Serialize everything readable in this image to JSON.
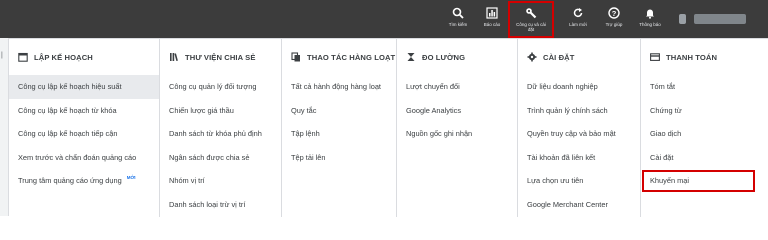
{
  "toolbar": {
    "buttons": [
      {
        "id": "search",
        "label": "Tìm kiếm",
        "icon": "search-icon"
      },
      {
        "id": "reports",
        "label": "Báo cáo",
        "icon": "reports-icon"
      },
      {
        "id": "tools",
        "label": "Công cụ và cài đặt",
        "icon": "wrench-icon"
      },
      {
        "id": "refresh",
        "label": "Làm mới",
        "icon": "refresh-icon"
      },
      {
        "id": "help",
        "label": "Trợ giúp",
        "icon": "help-icon"
      },
      {
        "id": "notifications",
        "label": "Thông báo",
        "icon": "bell-icon"
      }
    ]
  },
  "columns": [
    {
      "heading": "LẬP KẾ HOẠCH",
      "icon": "calendar-icon",
      "items": [
        {
          "label": "Công cụ lập kế hoạch hiệu suất"
        },
        {
          "label": "Công cụ lập kế hoạch từ khóa"
        },
        {
          "label": "Công cụ lập kế hoạch tiếp cận"
        },
        {
          "label": "Xem trước và chẩn đoán quảng cáo"
        },
        {
          "label": "Trung tâm quảng cáo ứng dụng",
          "badge": "MỚI"
        }
      ]
    },
    {
      "heading": "THƯ VIỆN CHIA SẺ",
      "icon": "library-icon",
      "items": [
        {
          "label": "Công cụ quản lý đối tượng"
        },
        {
          "label": "Chiến lược giá thầu"
        },
        {
          "label": "Danh sách từ khóa phủ định"
        },
        {
          "label": "Ngân sách được chia sẻ"
        },
        {
          "label": "Nhóm vị trí"
        },
        {
          "label": "Danh sách loại trừ vị trí"
        }
      ]
    },
    {
      "heading": "THAO TÁC HÀNG LOẠT",
      "icon": "copy-icon",
      "items": [
        {
          "label": "Tất cả hành động hàng loạt"
        },
        {
          "label": "Quy tắc"
        },
        {
          "label": "Tập lệnh"
        },
        {
          "label": "Tệp tải lên"
        }
      ]
    },
    {
      "heading": "ĐO LƯỜNG",
      "icon": "hourglass-icon",
      "items": [
        {
          "label": "Lượt chuyển đổi"
        },
        {
          "label": "Google Analytics"
        },
        {
          "label": "Nguồn gốc ghi nhận"
        }
      ]
    },
    {
      "heading": "CÀI ĐẶT",
      "icon": "settings-icon",
      "items": [
        {
          "label": "Dữ liệu doanh nghiệp"
        },
        {
          "label": "Trình quản lý chính sách"
        },
        {
          "label": "Quyền truy cập và bảo mật"
        },
        {
          "label": "Tài khoản đã liên kết"
        },
        {
          "label": "Lựa chọn ưu tiên"
        },
        {
          "label": "Google Merchant Center"
        }
      ]
    },
    {
      "heading": "THANH TOÁN",
      "icon": "credit-card-icon",
      "items": [
        {
          "label": "Tóm tắt"
        },
        {
          "label": "Chứng từ"
        },
        {
          "label": "Giao dịch"
        },
        {
          "label": "Cài đặt"
        },
        {
          "label": "Khuyến mại",
          "highlighted": true
        }
      ]
    }
  ]
}
